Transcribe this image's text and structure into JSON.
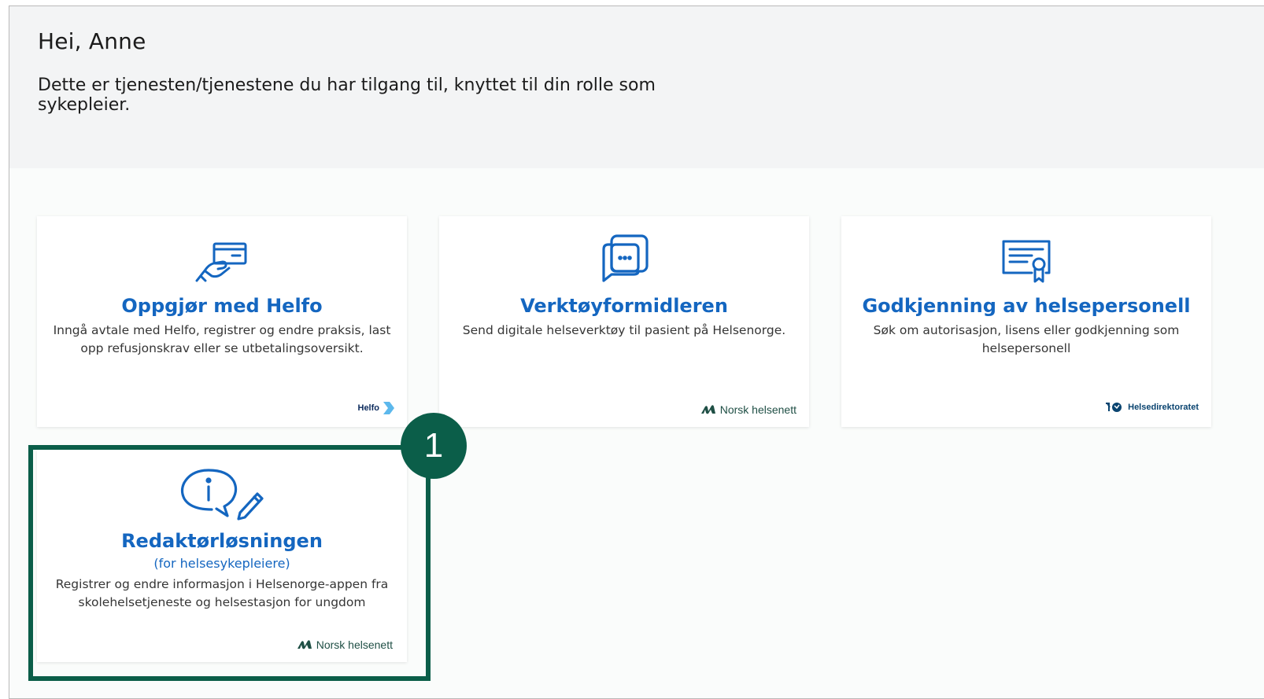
{
  "greeting": "Hei, Anne",
  "intro": "Dette er tjenesten/tjenestene du har tilgang til, knyttet til din rolle som sykepleier.",
  "cards": [
    {
      "title": "Oppgjør med Helfo",
      "description": "Inngå avtale med Helfo, registrer og endre praksis, last opp refusjonskrav eller se utbetalingsoversikt.",
      "icon": "card-payment-icon",
      "logo": "Helfo"
    },
    {
      "title": "Verktøyformidleren",
      "description": "Send digitale helseverktøy til pasient på Helsenorge.",
      "icon": "chat-bubbles-icon",
      "logo": "Norsk helsenett"
    },
    {
      "title": "Godkjenning av helsepersonell",
      "description": "Søk om autorisasjon, lisens eller godkjenning som helsepersonell",
      "icon": "certificate-icon",
      "logo": "Helsedirektoratet"
    },
    {
      "title": "Redaktørløsningen",
      "subtitle": "(for helsesykepleiere)",
      "description": "Registrer og endre informasjon i Helsenorge-appen fra skolehelsetjeneste og helsestasjon for ungdom",
      "icon": "info-edit-icon",
      "logo": "Norsk helsenett"
    }
  ],
  "annotation": {
    "number": "1"
  },
  "colors": {
    "title_blue": "#1466c0",
    "icon_blue": "#1466c0",
    "highlight_green": "#0b5e49",
    "header_bg": "#f3f4f5"
  }
}
